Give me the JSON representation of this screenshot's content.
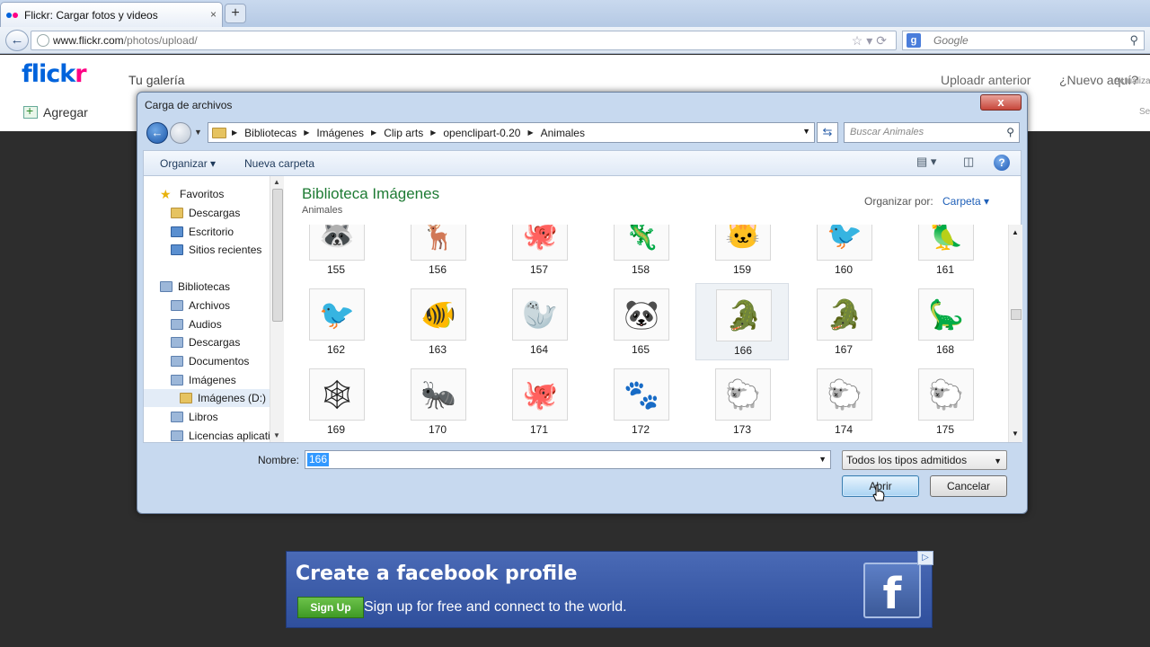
{
  "browser": {
    "tab_title": "Flickr: Cargar fotos y videos",
    "tab_close": "×",
    "new_tab": "+",
    "url_host": "www.flickr.com",
    "url_path": "/photos/upload/",
    "search_engine_icon": "g",
    "search_placeholder": "Google"
  },
  "flickr": {
    "logo_part1": "flick",
    "logo_part2": "r",
    "nav_galeria": "Tu galería",
    "uploadr_link": "Uploadr anterior",
    "nuevo_link": "¿Nuevo aquí?",
    "actualiza": "Actualiza",
    "agregar": "Agregar",
    "sel": "Se"
  },
  "dialog": {
    "title": "Carga de archivos",
    "close": "x",
    "breadcrumb": [
      "Bibliotecas",
      "Imágenes",
      "Clip arts",
      "openclipart-0.20",
      "Animales"
    ],
    "search_placeholder": "Buscar Animales",
    "toolbar": {
      "organize": "Organizar",
      "new_folder": "Nueva carpeta"
    },
    "sidebar": [
      {
        "label": "Favoritos",
        "icon": "star-icon"
      },
      {
        "label": "Descargas",
        "icon": "folder-icon"
      },
      {
        "label": "Escritorio",
        "icon": "desktop-icon"
      },
      {
        "label": "Sitios recientes",
        "icon": "recent-icon"
      },
      {
        "label": "Bibliotecas",
        "icon": "library-icon"
      },
      {
        "label": "Archivos",
        "icon": "library-icon"
      },
      {
        "label": "Audios",
        "icon": "library-icon"
      },
      {
        "label": "Descargas",
        "icon": "library-icon"
      },
      {
        "label": "Documentos",
        "icon": "library-icon"
      },
      {
        "label": "Imágenes",
        "icon": "library-icon"
      },
      {
        "label": "Imágenes (D:)",
        "icon": "folder-icon"
      },
      {
        "label": "Libros",
        "icon": "library-icon"
      },
      {
        "label": "Licencias aplicati",
        "icon": "library-icon"
      }
    ],
    "library_title": "Biblioteca Imágenes",
    "library_subtitle": "Animales",
    "arrange_label": "Organizar por:",
    "arrange_value": "Carpeta",
    "files": [
      {
        "name": "155",
        "glyph": "🦝"
      },
      {
        "name": "156",
        "glyph": "🦌"
      },
      {
        "name": "157",
        "glyph": "🐙"
      },
      {
        "name": "158",
        "glyph": "🦎"
      },
      {
        "name": "159",
        "glyph": "🐱"
      },
      {
        "name": "160",
        "glyph": "🐦"
      },
      {
        "name": "161",
        "glyph": "🦜"
      },
      {
        "name": "162",
        "glyph": "🐦"
      },
      {
        "name": "163",
        "glyph": "🐠"
      },
      {
        "name": "164",
        "glyph": "🦭"
      },
      {
        "name": "165",
        "glyph": "🐼"
      },
      {
        "name": "166",
        "glyph": "🐊"
      },
      {
        "name": "167",
        "glyph": "🐊"
      },
      {
        "name": "168",
        "glyph": "🦕"
      },
      {
        "name": "169",
        "glyph": "🕸"
      },
      {
        "name": "170",
        "glyph": "🐜"
      },
      {
        "name": "171",
        "glyph": "🐙"
      },
      {
        "name": "172",
        "glyph": "🐾"
      },
      {
        "name": "173",
        "glyph": "🐑"
      },
      {
        "name": "174",
        "glyph": "🐑"
      },
      {
        "name": "175",
        "glyph": "🐑"
      }
    ],
    "selected_file": "166",
    "name_label": "Nombre:",
    "name_value": "166",
    "file_type": "Todos los tipos admitidos",
    "open_button": "Abrir",
    "cancel_button": "Cancelar"
  },
  "ad": {
    "title": "Create a facebook profile",
    "signup": "Sign Up",
    "tagline": "Sign up for free and connect to the world.",
    "logo_letter": "f",
    "adchoice": "▷"
  },
  "colors": {
    "flickr_blue": "#0063dc",
    "flickr_pink": "#ff0084",
    "library_title_green": "#1e7b34",
    "facebook_blue": "#3b5998"
  }
}
